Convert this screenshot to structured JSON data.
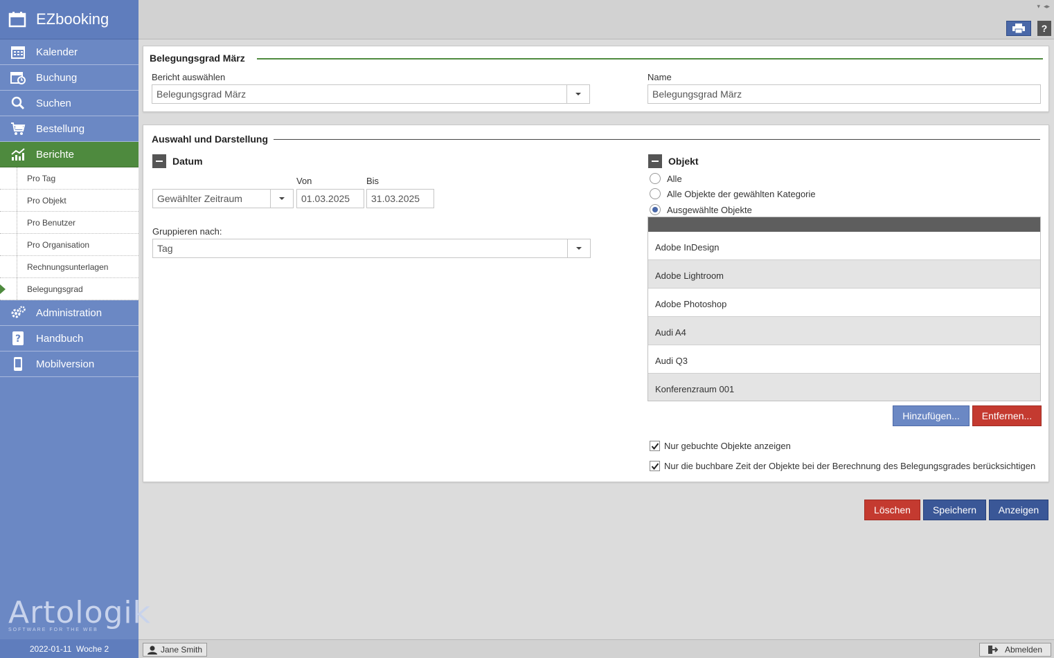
{
  "app": {
    "title": "EZbooking"
  },
  "sidebar": {
    "items": [
      {
        "label": "Kalender",
        "icon": "calendar-icon"
      },
      {
        "label": "Buchung",
        "icon": "booking-icon"
      },
      {
        "label": "Suchen",
        "icon": "search-icon"
      },
      {
        "label": "Bestellung",
        "icon": "cart-icon"
      },
      {
        "label": "Berichte",
        "icon": "chart-icon",
        "active": true
      }
    ],
    "sub_items": [
      {
        "label": "Pro Tag"
      },
      {
        "label": "Pro Objekt"
      },
      {
        "label": "Pro Benutzer"
      },
      {
        "label": "Pro Organisation"
      },
      {
        "label": "Rechnungsunterlagen"
      },
      {
        "label": "Belegungsgrad",
        "active": true
      }
    ],
    "items_after": [
      {
        "label": "Administration",
        "icon": "gears-icon"
      },
      {
        "label": "Handbuch",
        "icon": "help-book-icon"
      },
      {
        "label": "Mobilversion",
        "icon": "mobile-icon"
      }
    ],
    "logo_text": "Artologik",
    "logo_tagline": "SOFTWARE FOR THE WEB",
    "footer": {
      "date": "2022-01-11",
      "week": "Woche 2"
    }
  },
  "panel1": {
    "title": "Belegungsgrad März",
    "report_label": "Bericht auswählen",
    "report_value": "Belegungsgrad März",
    "name_label": "Name",
    "name_value": "Belegungsgrad März"
  },
  "panel2": {
    "title": "Auswahl und Darstellung",
    "datum": {
      "title": "Datum",
      "period_value": "Gewählter Zeitraum",
      "from_label": "Von",
      "from_value": "01.03.2025",
      "to_label": "Bis",
      "to_value": "31.03.2025",
      "group_label": "Gruppieren nach:",
      "group_value": "Tag"
    },
    "objekt": {
      "title": "Objekt",
      "radios": [
        {
          "label": "Alle",
          "checked": false
        },
        {
          "label": "Alle Objekte der gewählten Kategorie",
          "checked": false
        },
        {
          "label": "Ausgewählte Objekte",
          "checked": true
        }
      ],
      "objects": [
        "Adobe InDesign",
        "Adobe Lightroom",
        "Adobe Photoshop",
        "Audi A4",
        "Audi Q3",
        "Konferenzraum 001"
      ],
      "add_label": "Hinzufügen...",
      "remove_label": "Entfernen...",
      "check1": "Nur gebuchte Objekte anzeigen",
      "check2": "Nur die buchbare Zeit der Objekte bei der Berechnung des Belegungsgrades berücksichtigen"
    }
  },
  "actions": {
    "delete": "Löschen",
    "save": "Speichern",
    "show": "Anzeigen"
  },
  "status": {
    "user": "Jane Smith",
    "logout": "Abmelden"
  },
  "colors": {
    "sidebar": "#6b88c4",
    "active_green": "#4e8a3e",
    "red": "#c43a30",
    "blue": "#3a5797"
  }
}
